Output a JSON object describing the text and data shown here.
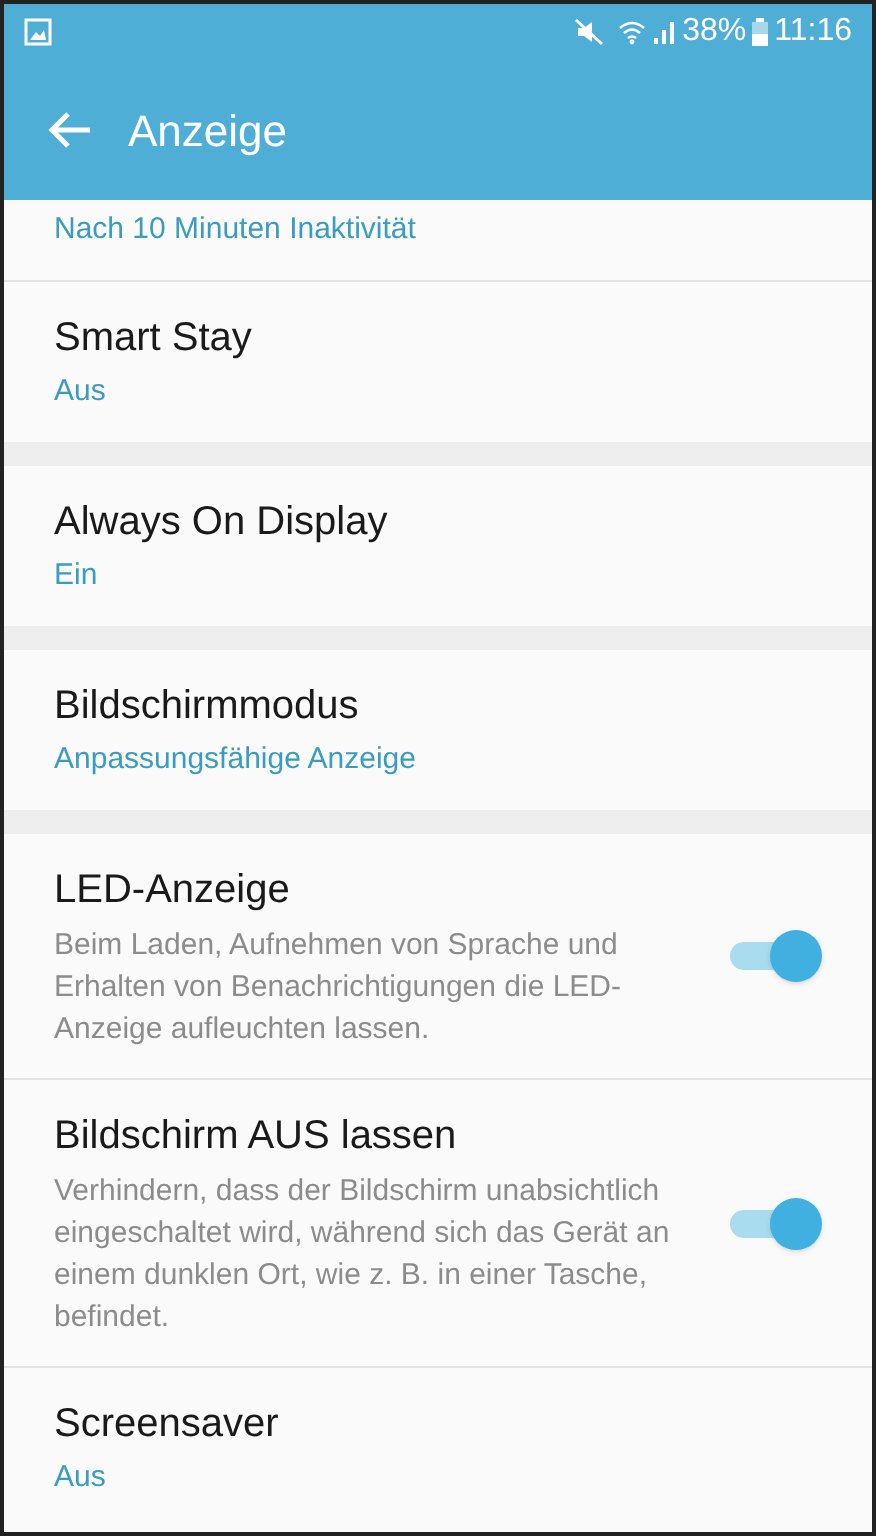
{
  "status_bar": {
    "battery": "38%",
    "time": "11:16"
  },
  "header": {
    "title": "Anzeige"
  },
  "groups": [
    {
      "items": [
        {
          "kind": "summary",
          "summary": "Nach 10 Minuten Inaktivität"
        },
        {
          "kind": "summary",
          "title": "Smart Stay",
          "summary": "Aus"
        }
      ]
    },
    {
      "items": [
        {
          "kind": "summary",
          "title": "Always On Display",
          "summary": "Ein"
        }
      ]
    },
    {
      "items": [
        {
          "kind": "summary",
          "title": "Bildschirmmodus",
          "summary": "Anpassungsfähige Anzeige"
        }
      ]
    },
    {
      "items": [
        {
          "kind": "toggle",
          "title": "LED-Anzeige",
          "summary": "Beim Laden, Aufnehmen von Sprache und Erhalten von Benachrichtigungen die LED-Anzeige aufleuchten lassen.",
          "on": true
        },
        {
          "kind": "toggle",
          "title": "Bildschirm AUS lassen",
          "summary": "Verhindern, dass der Bildschirm unabsichtlich eingeschaltet wird, während sich das Gerät an einem dunklen Ort, wie z. B. in einer Tasche, befindet.",
          "on": true
        },
        {
          "kind": "summary",
          "title": "Screensaver",
          "summary": "Aus"
        }
      ]
    }
  ]
}
